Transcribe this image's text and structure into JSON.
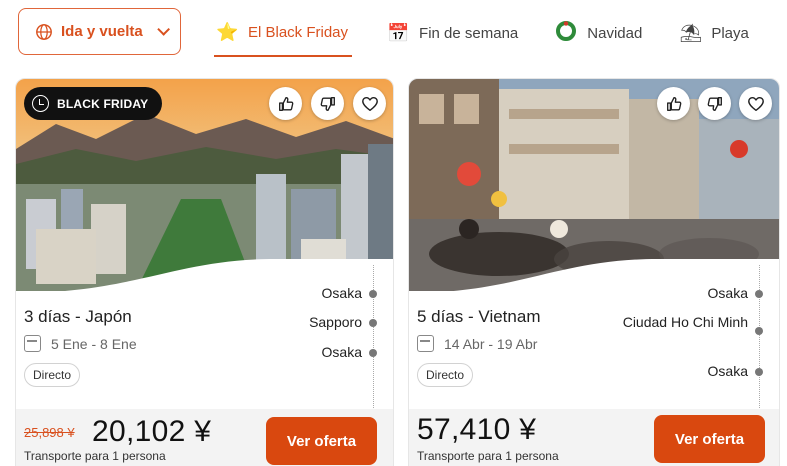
{
  "colors": {
    "accent": "#d9511f",
    "cta": "#d9480f",
    "badge_bg": "#111111"
  },
  "trip_type": {
    "label": "Ida y vuelta",
    "icon": "globe-icon"
  },
  "tabs": [
    {
      "label": "El Black Friday",
      "icon": "star-icon",
      "active": true
    },
    {
      "label": "Fin de semana",
      "icon": "calendar-icon",
      "active": false
    },
    {
      "label": "Navidad",
      "icon": "wreath-icon",
      "active": false
    },
    {
      "label": "Playa",
      "icon": "beach-umbrella-icon",
      "active": false
    },
    {
      "label": "",
      "icon": "snowflake-icon",
      "active": false
    }
  ],
  "cards": [
    {
      "badge": "BLACK FRIDAY",
      "title": "3 días - Japón",
      "dates": "5 Ene - 8 Ene",
      "flight_type": "Directo",
      "route": [
        "Osaka",
        "Sapporo",
        "Osaka"
      ],
      "old_price": "25,898 ¥",
      "price": "20,102 ¥",
      "price_note": "Transporte para 1 persona",
      "cta": "Ver oferta"
    },
    {
      "badge": "",
      "title": "5 días - Vietnam",
      "dates": "14 Abr - 19 Abr",
      "flight_type": "Directo",
      "route": [
        "Osaka",
        "Ciudad Ho Chi Minh",
        "Osaka"
      ],
      "old_price": "",
      "price": "57,410 ¥",
      "price_note": "Transporte para 1 persona",
      "cta": "Ver oferta"
    }
  ]
}
